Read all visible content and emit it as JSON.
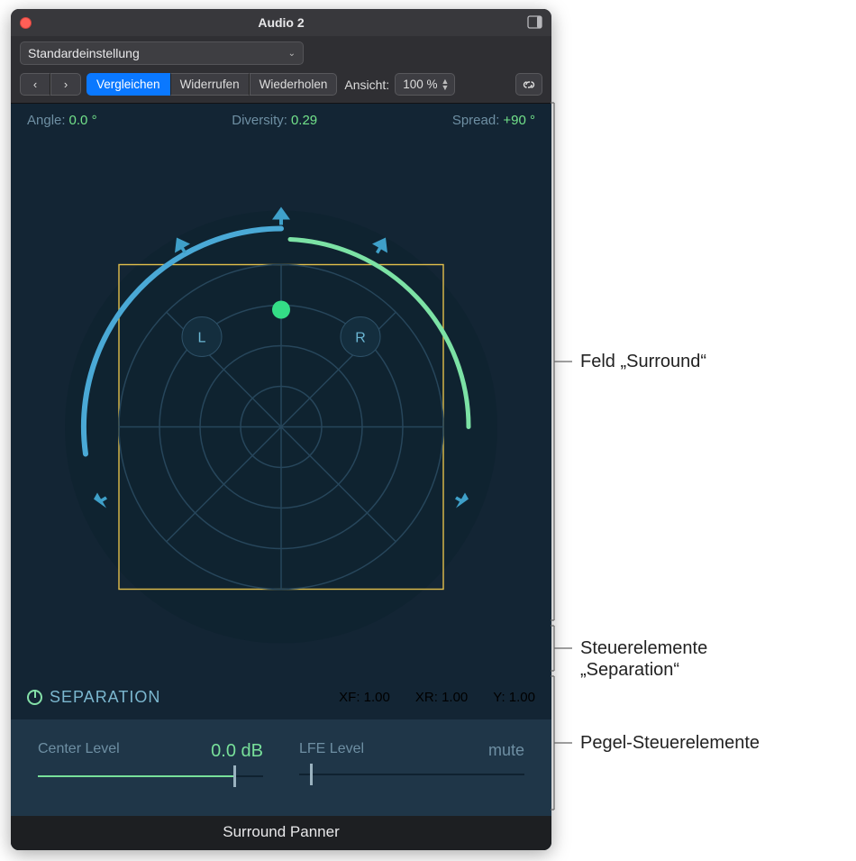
{
  "window": {
    "title": "Audio 2",
    "preset": "Standardeinstellung",
    "nav": {
      "back": "‹",
      "forward": "›"
    },
    "compare": "Vergleichen",
    "undo": "Widerrufen",
    "redo": "Wiederholen",
    "view_label": "Ansicht:",
    "view_value": "100 %"
  },
  "params": {
    "angle_label": "Angle:",
    "angle_value": "0.0 °",
    "diversity_label": "Diversity:",
    "diversity_value": "0.29",
    "spread_label": "Spread:",
    "spread_value": "+90 °"
  },
  "surround": {
    "left_label": "L",
    "right_label": "R"
  },
  "separation": {
    "title": "SEPARATION",
    "xf_label": "XF:",
    "xf_value": "1.00",
    "xr_label": "XR:",
    "xr_value": "1.00",
    "y_label": "Y:",
    "y_value": "1.00"
  },
  "levels": {
    "center_label": "Center Level",
    "center_value": "0.0 dB",
    "center_pos": 0.87,
    "lfe_label": "LFE Level",
    "lfe_mute": "mute",
    "lfe_pos": 0.05
  },
  "footer": "Surround Panner",
  "callouts": {
    "surround": "Feld „Surround“",
    "separation_l1": "Steuerelemente",
    "separation_l2": "„Separation“",
    "levels": "Pegel-Steuerelemente"
  }
}
